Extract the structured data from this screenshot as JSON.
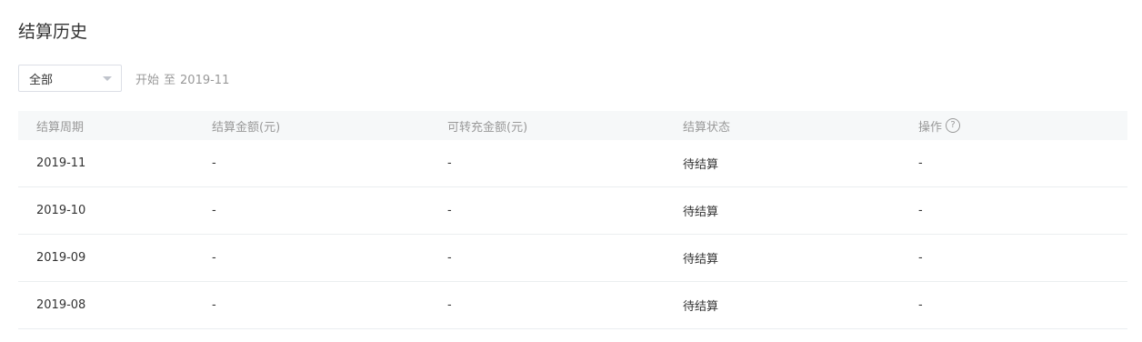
{
  "page": {
    "title": "结算历史"
  },
  "filter": {
    "select_value": "全部",
    "range_start": "开始",
    "range_sep": "至",
    "range_end": "2019-11"
  },
  "table": {
    "columns": [
      "结算周期",
      "结算金额(元)",
      "可转充金额(元)",
      "结算状态",
      "操作"
    ],
    "help_icon_glyph": "?",
    "rows": [
      {
        "period": "2019-11",
        "amount": "-",
        "transferable": "-",
        "status": "待结算",
        "action": "-"
      },
      {
        "period": "2019-10",
        "amount": "-",
        "transferable": "-",
        "status": "待结算",
        "action": "-"
      },
      {
        "period": "2019-09",
        "amount": "-",
        "transferable": "-",
        "status": "待结算",
        "action": "-"
      },
      {
        "period": "2019-08",
        "amount": "-",
        "transferable": "-",
        "status": "待结算",
        "action": "-"
      }
    ]
  },
  "colors": {
    "header_bg": "#f6f8f9",
    "muted_text": "#999999",
    "body_text": "#333333",
    "border": "#ebeef0"
  }
}
